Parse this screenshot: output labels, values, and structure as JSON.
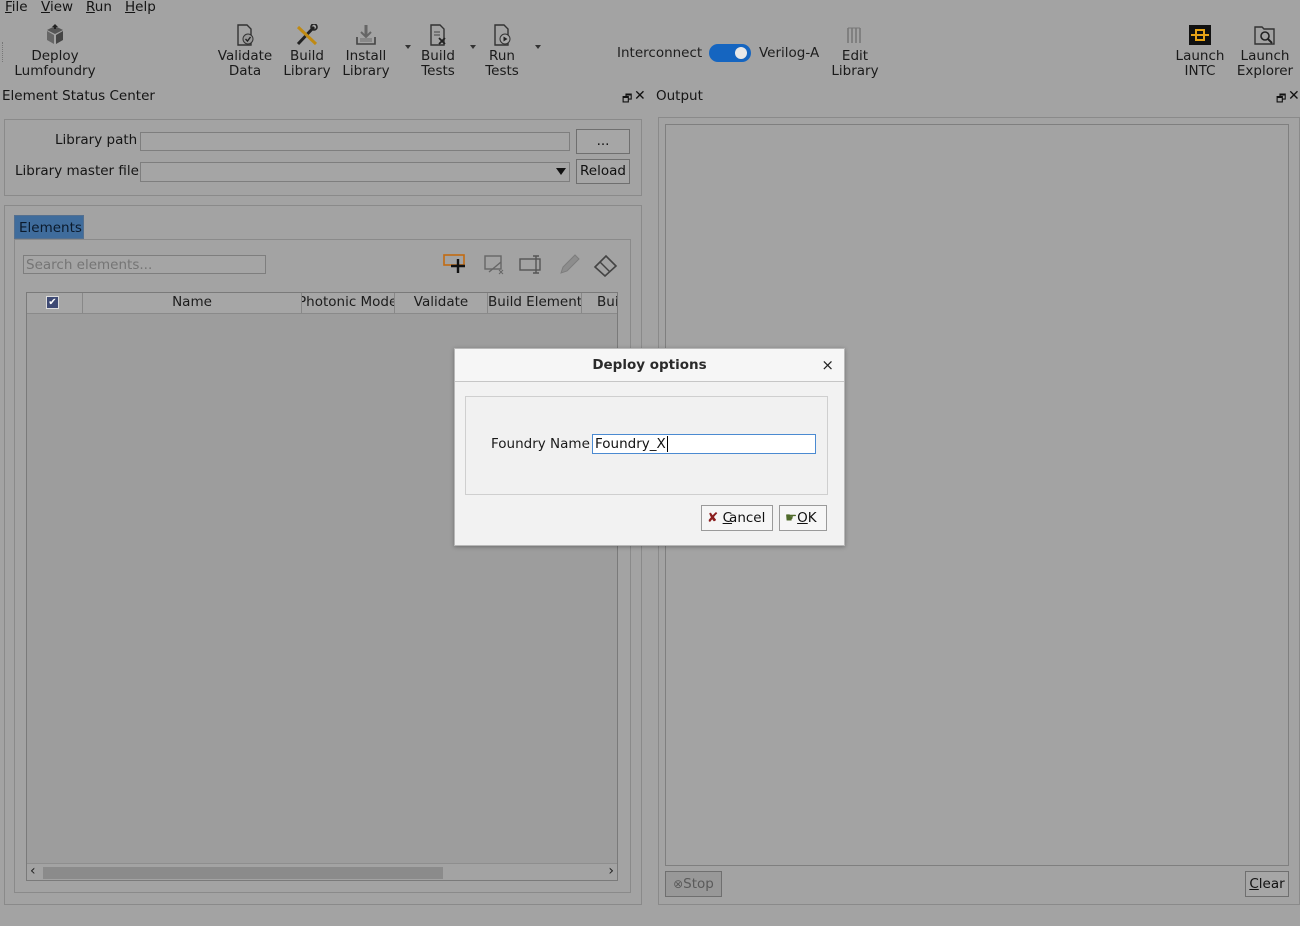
{
  "menu": [
    {
      "key": "F",
      "rest": "ile"
    },
    {
      "key": "V",
      "rest": "iew"
    },
    {
      "key": "R",
      "rest": "un"
    },
    {
      "key": "H",
      "rest": "elp"
    }
  ],
  "toolbar": {
    "deploy": [
      "Deploy",
      "Lumfoundry"
    ],
    "validate": [
      "Validate",
      "Data"
    ],
    "build_library": [
      "Build",
      "Library"
    ],
    "install_library": [
      "Install",
      "Library"
    ],
    "build_tests": [
      "Build",
      "Tests"
    ],
    "run_tests": [
      "Run",
      "Tests"
    ],
    "interconnect": "Interconnect",
    "veriloga": "Verilog-A",
    "edit_library": [
      "Edit",
      "Library"
    ],
    "launch_intc": [
      "Launch",
      "INTC"
    ],
    "launch_explorer": [
      "Launch",
      "Explorer"
    ]
  },
  "left_dock": {
    "title": "Element Status Center",
    "library_path_label": "Library path",
    "library_path_value": "",
    "browse_label": "...",
    "master_file_label": "Library master file",
    "master_file_value": "",
    "reload_label": "Reload",
    "tab_label": "Elements",
    "search_placeholder": "Search elements...",
    "columns": [
      "",
      "Name",
      "Photonic Mode",
      "Validate",
      "Build Element",
      "Bui"
    ]
  },
  "right_dock": {
    "title": "Output",
    "stop_label": "Stop",
    "clear_key": "C",
    "clear_rest": "lear"
  },
  "dialog": {
    "title": "Deploy options",
    "close": "×",
    "field_label": "Foundry Name",
    "field_value": "Foundry_X",
    "cancel_key": "C",
    "cancel_rest": "ancel",
    "ok_key": "O",
    "ok_rest": "K"
  },
  "colors": {
    "toggle_on": "#1565c0",
    "tab_active": "#3f6c9c",
    "input_focus": "#4b8ad1"
  }
}
